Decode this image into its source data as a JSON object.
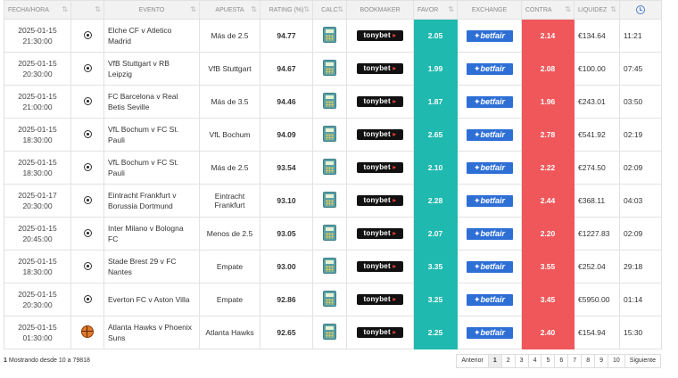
{
  "headers": {
    "fecha": "FECHA/HORA",
    "evento": "EVENTO",
    "apuesta": "APUESTA",
    "rating": "RATING (%)",
    "calc": "CALC",
    "bookmaker": "BOOKMAKER",
    "favor": "FAVOR",
    "exchange": "EXCHANGE",
    "contra": "CONTRA",
    "liquidez": "LIQUIDEZ"
  },
  "bookmaker_label": "tonybet",
  "exchange_label": "betfair",
  "colors": {
    "favor": "#1fb9b0",
    "contra": "#f0575b"
  },
  "rows": [
    {
      "date": "2025-01-15",
      "time": "21:30:00",
      "sport": "soccer-ball-icon",
      "event": "Elche CF v Atletico Madrid",
      "bet": "Más de 2.5",
      "rating": "94.77",
      "favor": "2.05",
      "contra": "2.14",
      "liquidity": "€134.64",
      "remaining": "11:21"
    },
    {
      "date": "2025-01-15",
      "time": "20:30:00",
      "sport": "soccer-ball-icon",
      "event": "VfB Stuttgart v RB Leipzig",
      "bet": "VfB Stuttgart",
      "rating": "94.67",
      "favor": "1.99",
      "contra": "2.08",
      "liquidity": "€100.00",
      "remaining": "07:45"
    },
    {
      "date": "2025-01-15",
      "time": "21:00:00",
      "sport": "soccer-ball-icon",
      "event": "FC Barcelona v Real Betis Seville",
      "bet": "Más de 3.5",
      "rating": "94.46",
      "favor": "1.87",
      "contra": "1.96",
      "liquidity": "€243.01",
      "remaining": "03:50"
    },
    {
      "date": "2025-01-15",
      "time": "18:30:00",
      "sport": "soccer-ball-icon",
      "event": "VfL Bochum v FC St. Pauli",
      "bet": "VfL Bochum",
      "rating": "94.09",
      "favor": "2.65",
      "contra": "2.78",
      "liquidity": "€541.92",
      "remaining": "02:19"
    },
    {
      "date": "2025-01-15",
      "time": "18:30:00",
      "sport": "soccer-ball-icon",
      "event": "VfL Bochum v FC St. Pauli",
      "bet": "Más de 2.5",
      "rating": "93.54",
      "favor": "2.10",
      "contra": "2.22",
      "liquidity": "€274.50",
      "remaining": "02:09"
    },
    {
      "date": "2025-01-17",
      "time": "20:30:00",
      "sport": "soccer-ball-icon",
      "event": "Eintracht Frankfurt v Borussia Dortmund",
      "bet": "Eintracht Frankfurt",
      "rating": "93.10",
      "favor": "2.28",
      "contra": "2.44",
      "liquidity": "€368.11",
      "remaining": "04:03"
    },
    {
      "date": "2025-01-15",
      "time": "20:45:00",
      "sport": "soccer-ball-icon",
      "event": "Inter Milano v Bologna FC",
      "bet": "Menos de 2.5",
      "rating": "93.05",
      "favor": "2.07",
      "contra": "2.20",
      "liquidity": "€1227.83",
      "remaining": "02:09"
    },
    {
      "date": "2025-01-15",
      "time": "18:30:00",
      "sport": "soccer-ball-icon",
      "event": "Stade Brest 29 v FC Nantes",
      "bet": "Empate",
      "rating": "93.00",
      "favor": "3.35",
      "contra": "3.55",
      "liquidity": "€252.04",
      "remaining": "29:18"
    },
    {
      "date": "2025-01-15",
      "time": "20:30:00",
      "sport": "soccer-ball-icon",
      "event": "Everton FC v Aston Villa",
      "bet": "Empate",
      "rating": "92.86",
      "favor": "3.25",
      "contra": "3.45",
      "liquidity": "€5950.00",
      "remaining": "01:14"
    },
    {
      "date": "2025-01-15",
      "time": "01:30:00",
      "sport": "basketball-icon",
      "event": "Atlanta Hawks v Phoenix Suns",
      "bet": "Atlanta Hawks",
      "rating": "92.65",
      "favor": "2.25",
      "contra": "2.40",
      "liquidity": "€154.94",
      "remaining": "15:30"
    }
  ],
  "footer": {
    "selected": "1",
    "info_text": "Mostrando desde 10 a 79818",
    "prev": "Anterior",
    "next": "Siguiente",
    "pages": [
      "1",
      "2",
      "3",
      "4",
      "5",
      "6",
      "7",
      "8",
      "9",
      "10"
    ],
    "active_page": "1"
  }
}
